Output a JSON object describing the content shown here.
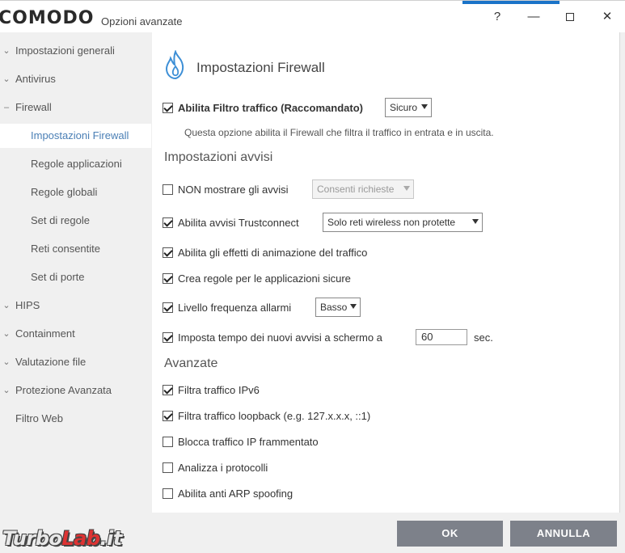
{
  "window": {
    "brand": "COMODO",
    "title": "Opzioni avanzate",
    "help_label": "?",
    "min_label": "—",
    "close_label": "✕"
  },
  "sidebar": {
    "items": [
      {
        "label": "Impostazioni generali",
        "chevron": "⌄"
      },
      {
        "label": "Antivirus",
        "chevron": "⌄"
      },
      {
        "label": "Firewall",
        "chevron": "–"
      },
      {
        "label": "Impostazioni Firewall"
      },
      {
        "label": "Regole applicazioni"
      },
      {
        "label": "Regole globali"
      },
      {
        "label": "Set di regole"
      },
      {
        "label": "Reti consentite"
      },
      {
        "label": "Set di porte"
      },
      {
        "label": "HIPS",
        "chevron": "⌄"
      },
      {
        "label": "Containment",
        "chevron": "⌄"
      },
      {
        "label": "Valutazione file",
        "chevron": "⌄"
      },
      {
        "label": "Protezione Avanzata",
        "chevron": "⌄"
      },
      {
        "label": "Filtro Web"
      }
    ]
  },
  "content": {
    "title": "Impostazioni Firewall",
    "icon": "flame-icon",
    "traffic_filter": {
      "label": "Abilita Filtro traffico (Raccomandato)",
      "checked": true,
      "mode": "Sicuro"
    },
    "description": "Questa opzione abilita il Firewall che filtra il traffico in entrata e in uscita.",
    "alerts_section": "Impostazioni avvisi",
    "no_alerts": {
      "label": "NON mostrare gli avvisi",
      "checked": false,
      "select": "Consenti richieste"
    },
    "trustconnect": {
      "label": "Abilita avvisi Trustconnect",
      "checked": true,
      "select": "Solo reti wireless non protette"
    },
    "animation": {
      "label": "Abilita gli effetti di animazione del traffico",
      "checked": true
    },
    "safe_rules": {
      "label": "Crea regole per le applicazioni sicure",
      "checked": true
    },
    "alert_freq": {
      "label": "Livello frequenza allarmi",
      "checked": true,
      "select": "Basso"
    },
    "alert_timeout": {
      "label": "Imposta tempo dei nuovi avvisi a schermo a",
      "checked": true,
      "value": "60",
      "unit": "sec."
    },
    "advanced_section": "Avanzate",
    "ipv6": {
      "label": "Filtra traffico IPv6",
      "checked": true
    },
    "loopback": {
      "label": "Filtra traffico loopback (e.g. 127.x.x.x, ::1)",
      "checked": true
    },
    "fragmented": {
      "label": "Blocca traffico IP frammentato",
      "checked": false
    },
    "protocols": {
      "label": "Analizza i protocolli",
      "checked": false
    },
    "arp": {
      "label": "Abilita anti ARP spoofing",
      "checked": false
    }
  },
  "footer": {
    "ok_label": "OK",
    "cancel_label": "ANNULLA",
    "watermark_a": "Turbo",
    "watermark_b": "Lab",
    "watermark_c": ".it"
  },
  "colors": {
    "accent": "#1a73c8",
    "active_nav": "#4a7fb5",
    "button": "#7d818a"
  }
}
